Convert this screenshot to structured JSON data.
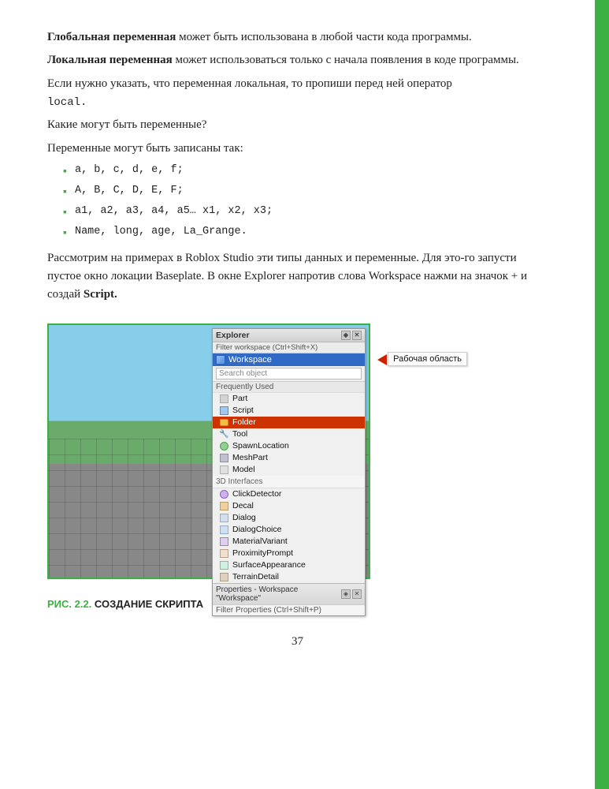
{
  "page": {
    "number": "37",
    "green_bar": true
  },
  "content": {
    "paragraph1_bold": "Глобальная переменная",
    "paragraph1_rest": " может быть использована в любой части кода программы.",
    "paragraph2_bold": "Локальная переменная",
    "paragraph2_rest": " может использоваться только с начала появления в коде программы.",
    "paragraph3": "Если нужно указать, что переменная локальная, то пропиши перед ней оператор",
    "paragraph3_code": "local.",
    "paragraph4": "Какие могут быть переменные?",
    "paragraph5": "Переменные могут быть записаны так:",
    "bullets": [
      {
        "text": "a, b,  c, d, e, f;"
      },
      {
        "text": "A, B, C, D,  E,  F;"
      },
      {
        "text": "a1, a2, a3, a4, a5…  x1, x2, x3;"
      },
      {
        "text": "Name, long, age, La_Grange."
      }
    ],
    "paragraph6_part1": "Рассмотрим на примерах в Roblox Studio эти типы данных и переменные. Для это-го запусти пустое окно локации Baseplate. В окне Explorer напротив слова Workspace нажми на значок + и создай ",
    "paragraph6_bold": "Script.",
    "figure_caption_green": "РИС. 2.2.",
    "figure_caption_text": " СОЗДАНИЕ СКРИПТА"
  },
  "explorer": {
    "title": "Explorer",
    "filter_label": "Filter workspace (Ctrl+Shift+X)",
    "workspace_label": "Workspace",
    "workspace_bubble": "Рабочая область",
    "search_placeholder": "Search object",
    "section_frequently_used": "Frequently Used",
    "items": [
      {
        "name": "Part",
        "icon": "part"
      },
      {
        "name": "Script",
        "icon": "script"
      },
      {
        "name": "Folder",
        "icon": "folder",
        "highlighted": true
      },
      {
        "name": "Tool",
        "icon": "tool"
      },
      {
        "name": "SpawnLocation",
        "icon": "spawn"
      },
      {
        "name": "MeshPart",
        "icon": "mesh"
      },
      {
        "name": "Model",
        "icon": "model"
      }
    ],
    "section_3d": "3D Interfaces",
    "items2": [
      {
        "name": "ClickDetector",
        "icon": "click"
      },
      {
        "name": "Decal",
        "icon": "decal"
      },
      {
        "name": "Dialog",
        "icon": "dialog"
      },
      {
        "name": "DialogChoice",
        "icon": "dialogchoice"
      },
      {
        "name": "MaterialVariant",
        "icon": "material"
      },
      {
        "name": "ProximityPrompt",
        "icon": "proximity"
      },
      {
        "name": "SurfaceAppearance",
        "icon": "surface"
      },
      {
        "name": "TerrainDetail",
        "icon": "terrain"
      }
    ],
    "properties_label": "Properties - Workspace \"Workspace\"",
    "filter_properties": "Filter Properties (Ctrl+Shift+P)"
  }
}
